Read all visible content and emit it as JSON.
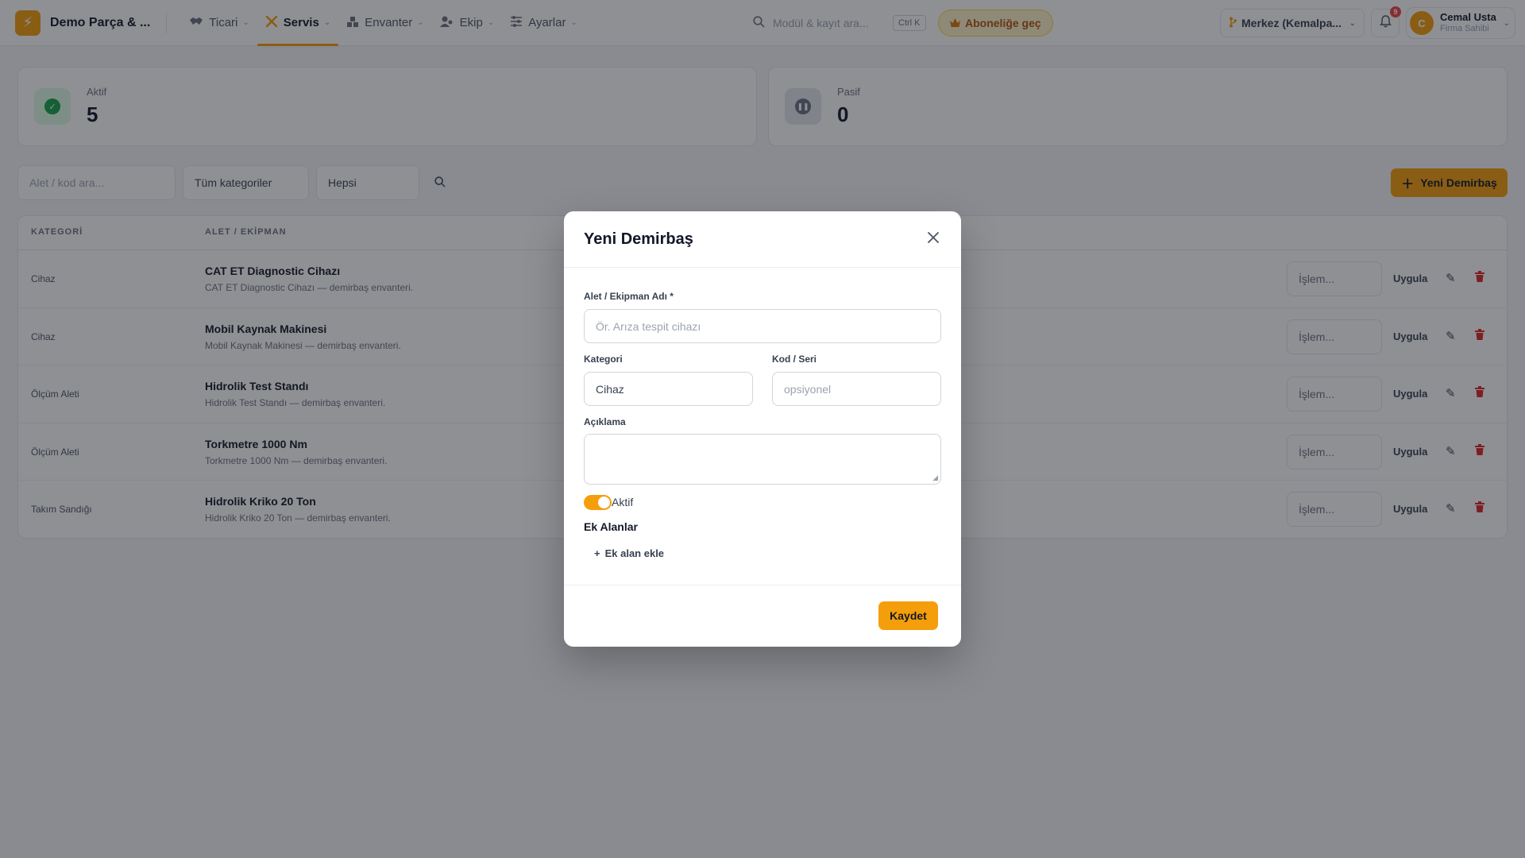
{
  "app": {
    "logo_glyph": "⚡",
    "name": "Demo Parça & ..."
  },
  "nav": {
    "items": [
      {
        "label": "Ticari",
        "icon": "handshake-icon"
      },
      {
        "label": "Servis",
        "icon": "tools-icon",
        "active": true
      },
      {
        "label": "Envanter",
        "icon": "warehouse-icon"
      },
      {
        "label": "Ekip",
        "icon": "team-icon"
      },
      {
        "label": "Ayarlar",
        "icon": "sliders-icon"
      }
    ]
  },
  "search": {
    "placeholder": "Modül & kayıt ara...",
    "shortcut": "Ctrl K"
  },
  "upgrade": {
    "label": "Aboneliğe geç"
  },
  "branch": {
    "label": "Merkez (Kemalpa..."
  },
  "notifications": {
    "count": "9"
  },
  "user": {
    "initial": "C",
    "name": "Cemal Usta",
    "role": "Firma Sahibi"
  },
  "stats": [
    {
      "label": "Aktif",
      "value": "5",
      "icon": "check-circle-icon",
      "color": "#16a34a"
    },
    {
      "label": "Pasif",
      "value": "0",
      "icon": "pause-circle-icon",
      "color": "#6b7280"
    }
  ],
  "filters": {
    "search_placeholder": "Alet / kod ara...",
    "category_value": "Tüm kategoriler",
    "status_value": "Hepsi"
  },
  "new_button": {
    "label": "Yeni Demirbaş"
  },
  "table": {
    "headers": [
      "KATEGORİ",
      "ALET / EKİPMAN"
    ],
    "rows": [
      {
        "category": "Cihaz",
        "title": "CAT ET Diagnostic Cihazı",
        "desc": "CAT ET Diagnostic Cihazı — demirbaş envanteri.",
        "action_placeholder": "İşlem...",
        "apply": "Uygula"
      },
      {
        "category": "Cihaz",
        "title": "Mobil Kaynak Makinesi",
        "desc": "Mobil Kaynak Makinesi — demirbaş envanteri.",
        "action_placeholder": "İşlem...",
        "apply": "Uygula"
      },
      {
        "category": "Ölçüm Aleti",
        "title": "Hidrolik Test Standı",
        "desc": "Hidrolik Test Standı — demirbaş envanteri.",
        "action_placeholder": "İşlem...",
        "apply": "Uygula"
      },
      {
        "category": "Ölçüm Aleti",
        "title": "Torkmetre 1000 Nm",
        "desc": "Torkmetre 1000 Nm — demirbaş envanteri.",
        "action_placeholder": "İşlem...",
        "apply": "Uygula"
      },
      {
        "category": "Takım Sandığı",
        "title": "Hidrolik Kriko 20 Ton",
        "desc": "Hidrolik Kriko 20 Ton — demirbaş envanteri.",
        "action_placeholder": "İşlem...",
        "apply": "Uygula"
      }
    ]
  },
  "modal": {
    "title": "Yeni Demirbaş",
    "name_label": "Alet / Ekipman Adı *",
    "name_placeholder": "Ör. Arıza tespit cihazı",
    "category_label": "Kategori",
    "category_value": "Cihaz",
    "code_label": "Kod / Seri",
    "code_placeholder": "opsiyonel",
    "desc_label": "Açıklama",
    "active_label": "Aktif",
    "active": true,
    "extra_section": "Ek Alanlar",
    "add_field": "Ek alan ekle",
    "save": "Kaydet"
  },
  "colors": {
    "accent": "#f59e0b",
    "danger": "#dc2626",
    "success": "#16a34a"
  }
}
